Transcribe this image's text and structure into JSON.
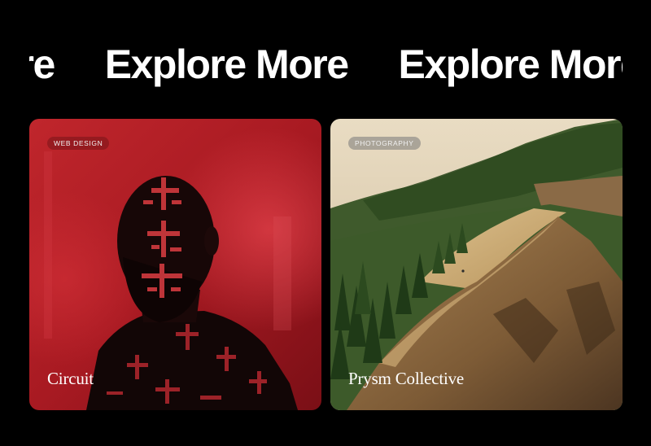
{
  "marquee": {
    "items": [
      "Explore More",
      "Explore More",
      "Explore More"
    ]
  },
  "cards": [
    {
      "tag": "WEB DESIGN",
      "title": "Circuit",
      "image": "portrait-with-projected-characters",
      "accent": "#c4232b"
    },
    {
      "tag": "PHOTOGRAPHY",
      "title": "Prysm Collective",
      "image": "mountain-ridge-landscape",
      "accent": "#b58a52"
    }
  ]
}
